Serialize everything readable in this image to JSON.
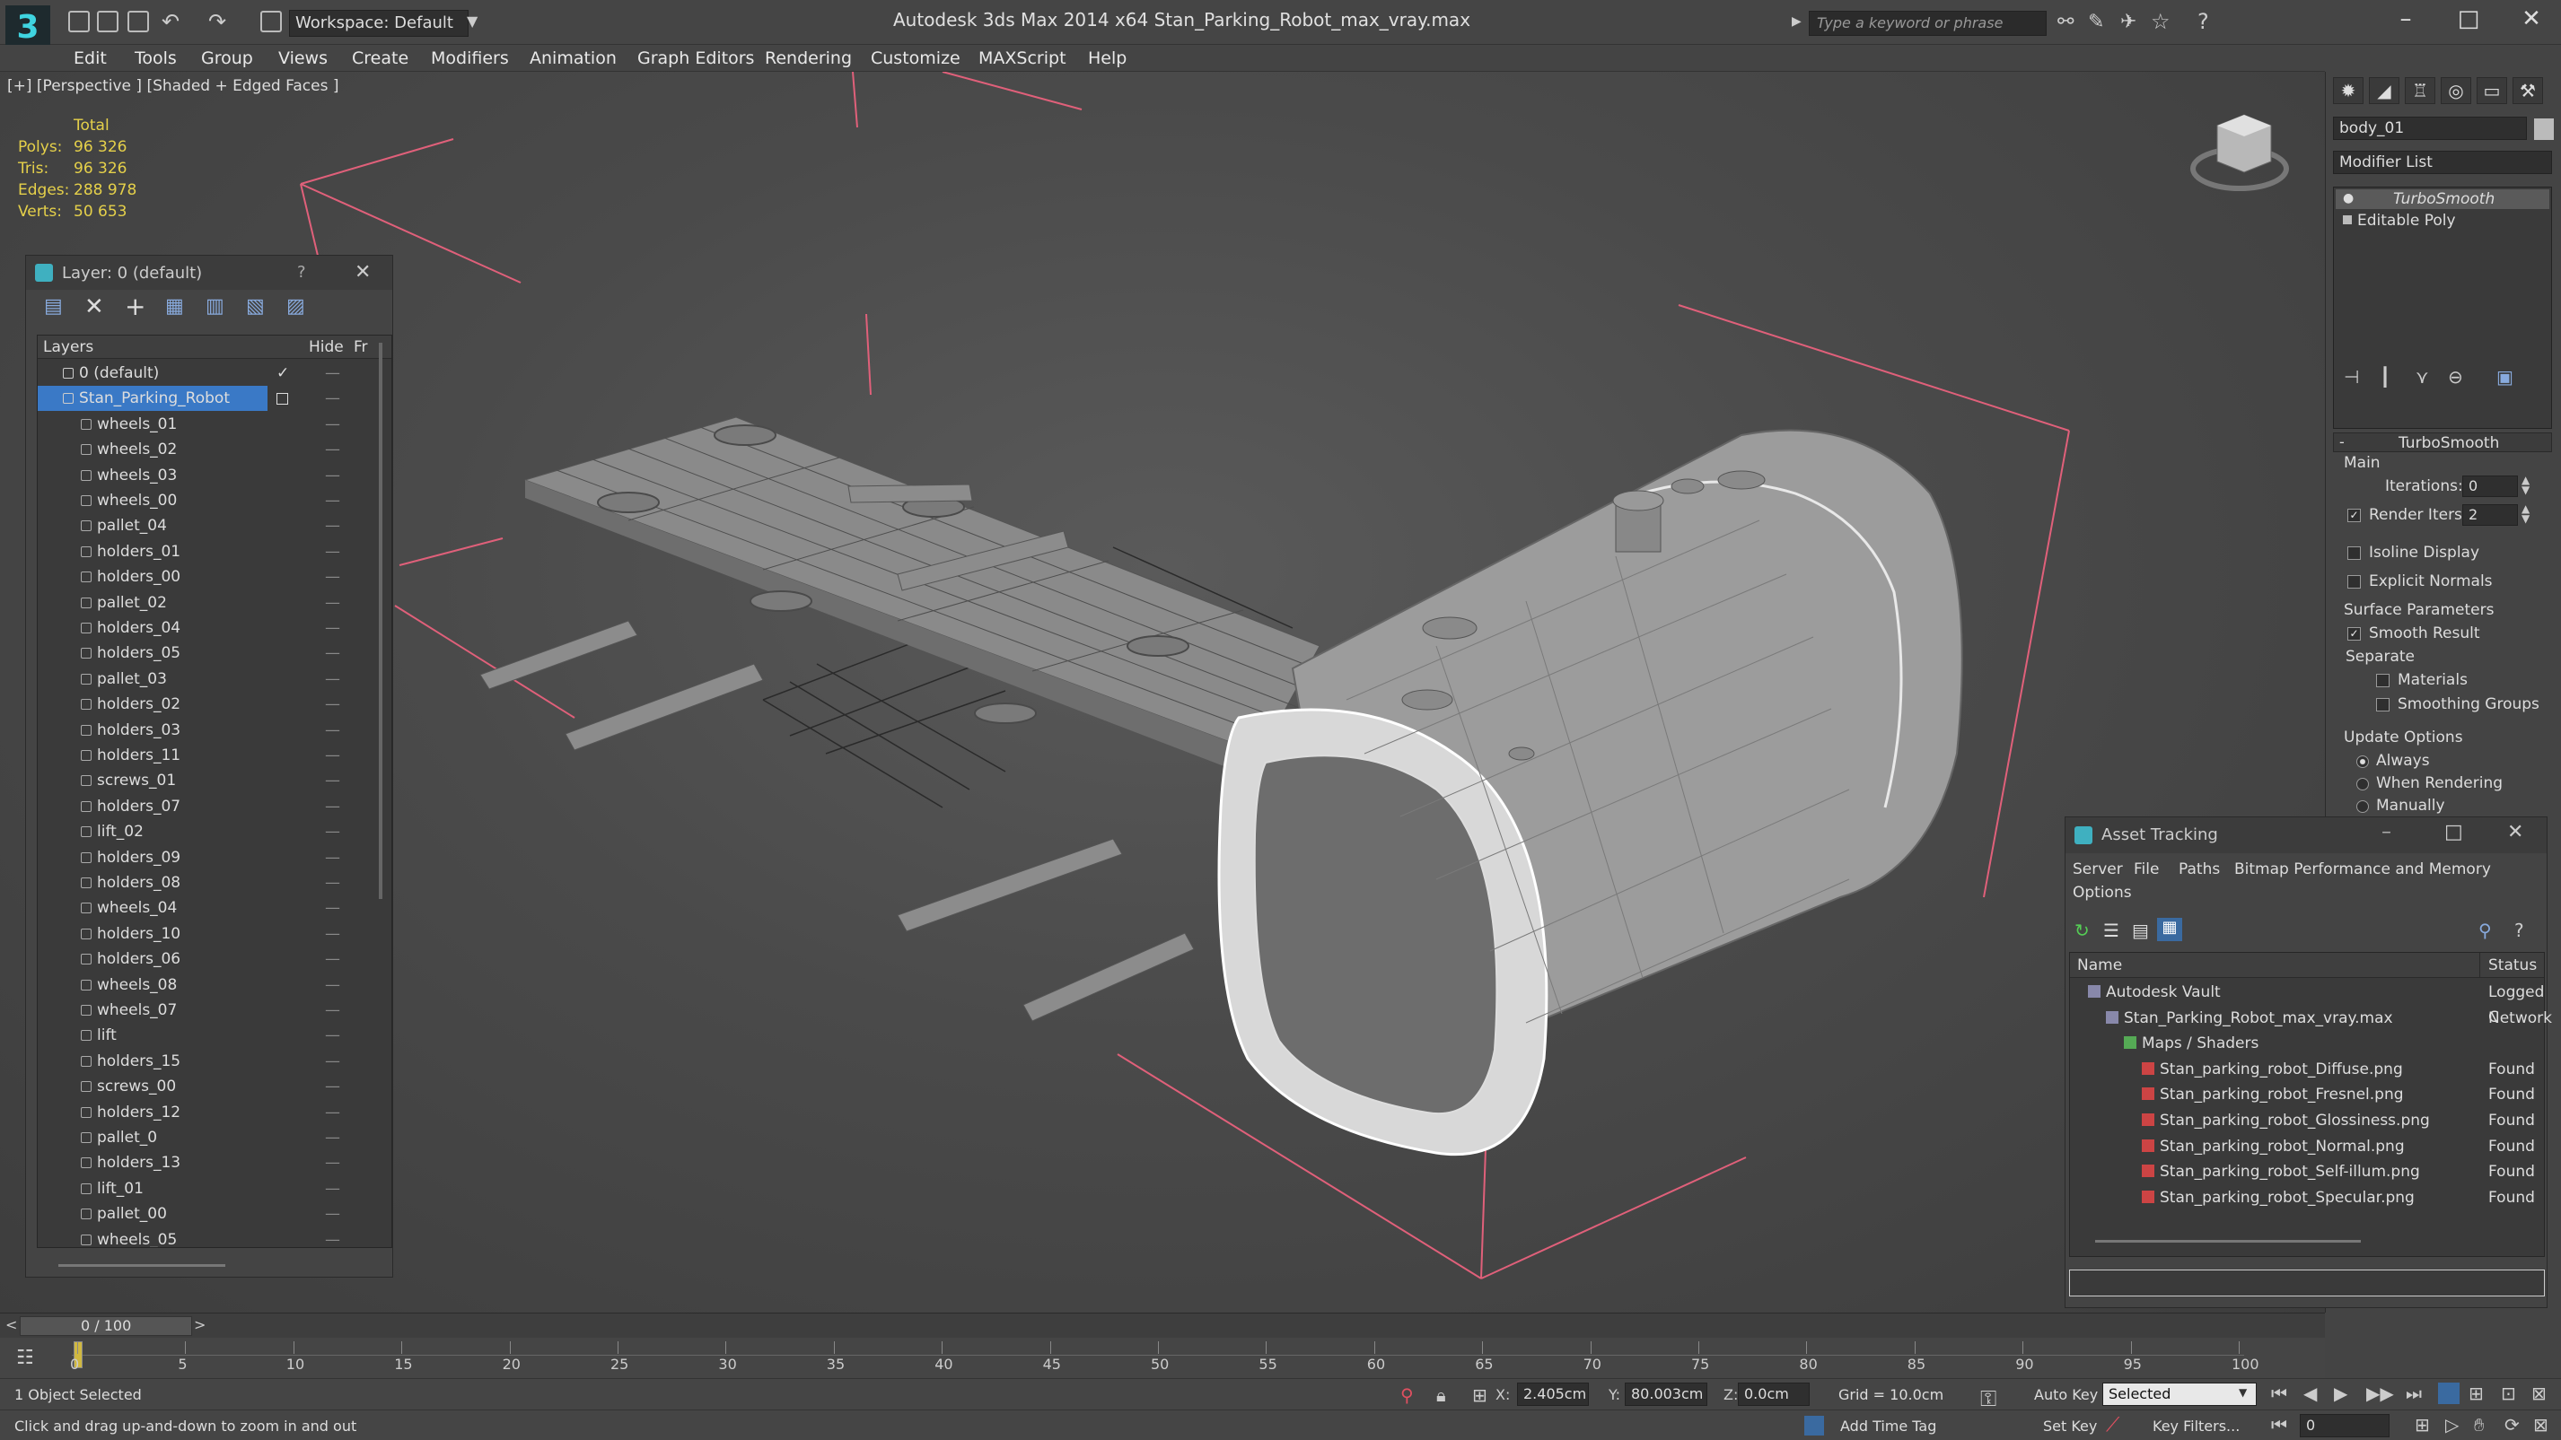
{
  "titlebar": {
    "workspace": "Workspace: Default",
    "app_title": "Autodesk 3ds Max  2014 x64      Stan_Parking_Robot_max_vray.max",
    "search_placeholder": "Type a keyword or phrase"
  },
  "menu": [
    "Edit",
    "Tools",
    "Group",
    "Views",
    "Create",
    "Modifiers",
    "Animation",
    "Graph Editors",
    "Rendering",
    "Customize",
    "MAXScript",
    "Help"
  ],
  "viewport": {
    "label": "[+] [Perspective ] [Shaded + Edged Faces ]",
    "stats": {
      "header": "Total",
      "rows": [
        {
          "label": "Polys:",
          "value": "96 326"
        },
        {
          "label": "Tris:",
          "value": "96 326"
        },
        {
          "label": "Edges:",
          "value": "288 978"
        },
        {
          "label": "Verts:",
          "value": "50 653"
        }
      ]
    }
  },
  "layer_panel": {
    "title": "Layer: 0 (default)",
    "help": "?",
    "col_layers": "Layers",
    "col_hide": "Hide",
    "col_freeze": "Fr",
    "rows": [
      {
        "name": "0 (default)",
        "level": 0,
        "selected": false,
        "check": "✓"
      },
      {
        "name": "Stan_Parking_Robot",
        "level": 0,
        "selected": true,
        "check": ""
      },
      {
        "name": "wheels_01",
        "level": 1
      },
      {
        "name": "wheels_02",
        "level": 1
      },
      {
        "name": "wheels_03",
        "level": 1
      },
      {
        "name": "wheels_00",
        "level": 1
      },
      {
        "name": "pallet_04",
        "level": 1
      },
      {
        "name": "holders_01",
        "level": 1
      },
      {
        "name": "holders_00",
        "level": 1
      },
      {
        "name": "pallet_02",
        "level": 1
      },
      {
        "name": "holders_04",
        "level": 1
      },
      {
        "name": "holders_05",
        "level": 1
      },
      {
        "name": "pallet_03",
        "level": 1
      },
      {
        "name": "holders_02",
        "level": 1
      },
      {
        "name": "holders_03",
        "level": 1
      },
      {
        "name": "holders_11",
        "level": 1
      },
      {
        "name": "screws_01",
        "level": 1
      },
      {
        "name": "holders_07",
        "level": 1
      },
      {
        "name": "lift_02",
        "level": 1
      },
      {
        "name": "holders_09",
        "level": 1
      },
      {
        "name": "holders_08",
        "level": 1
      },
      {
        "name": "wheels_04",
        "level": 1
      },
      {
        "name": "holders_10",
        "level": 1
      },
      {
        "name": "holders_06",
        "level": 1
      },
      {
        "name": "wheels_08",
        "level": 1
      },
      {
        "name": "wheels_07",
        "level": 1
      },
      {
        "name": "lift",
        "level": 1
      },
      {
        "name": "holders_15",
        "level": 1
      },
      {
        "name": "screws_00",
        "level": 1
      },
      {
        "name": "holders_12",
        "level": 1
      },
      {
        "name": "pallet_0",
        "level": 1
      },
      {
        "name": "holders_13",
        "level": 1
      },
      {
        "name": "lift_01",
        "level": 1
      },
      {
        "name": "pallet_00",
        "level": 1
      },
      {
        "name": "wheels_05",
        "level": 1
      }
    ]
  },
  "command_panel": {
    "object_name": "body_01",
    "modifier_list": "Modifier List",
    "stack": [
      "TurboSmooth",
      "Editable Poly"
    ],
    "rollout_title": "TurboSmooth",
    "main": "Main",
    "iterations_label": "Iterations:",
    "iterations_value": "0",
    "render_iters_label": "Render Iters:",
    "render_iters_value": "2",
    "isoline": "Isoline Display",
    "explicit_normals": "Explicit Normals",
    "surface_params": "Surface Parameters",
    "smooth_result": "Smooth Result",
    "separate": "Separate",
    "materials": "Materials",
    "smoothing_groups": "Smoothing Groups",
    "update_options": "Update Options",
    "always": "Always",
    "when_rendering": "When Rendering",
    "manually": "Manually"
  },
  "asset_tracking": {
    "title": "Asset Tracking",
    "menu": [
      "Server",
      "File",
      "Paths",
      "Bitmap Performance and Memory"
    ],
    "options": "Options",
    "col_name": "Name",
    "col_status": "Status",
    "rows": [
      {
        "name": "Autodesk Vault",
        "status": "Logged C",
        "indent": 1
      },
      {
        "name": "Stan_Parking_Robot_max_vray.max",
        "status": "Network",
        "indent": 2
      },
      {
        "name": "Maps / Shaders",
        "status": "",
        "indent": 3
      },
      {
        "name": "Stan_parking_robot_Diffuse.png",
        "status": "Found",
        "indent": 4
      },
      {
        "name": "Stan_parking_robot_Fresnel.png",
        "status": "Found",
        "indent": 4
      },
      {
        "name": "Stan_parking_robot_Glossiness.png",
        "status": "Found",
        "indent": 4
      },
      {
        "name": "Stan_parking_robot_Normal.png",
        "status": "Found",
        "indent": 4
      },
      {
        "name": "Stan_parking_robot_Self-illum.png",
        "status": "Found",
        "indent": 4
      },
      {
        "name": "Stan_parking_robot_Specular.png",
        "status": "Found",
        "indent": 4
      }
    ]
  },
  "timeline": {
    "frame": "0 / 100",
    "ticks": [
      "0",
      "5",
      "10",
      "15",
      "20",
      "25",
      "30",
      "35",
      "40",
      "45",
      "50",
      "55",
      "60",
      "65",
      "70",
      "75",
      "80",
      "85",
      "90",
      "95",
      "100"
    ]
  },
  "status": {
    "selection": "1 Object Selected",
    "hint": "Click and drag up-and-down to zoom in and out",
    "x_label": "X:",
    "x_value": "2.405cm",
    "y_label": "Y:",
    "y_value": "80.003cm",
    "z_label": "Z:",
    "z_value": "0.0cm",
    "grid": "Grid = 10.0cm",
    "auto_key": "Auto Key",
    "selected": "Selected",
    "set_key": "Set Key",
    "key_filters": "Key Filters...",
    "add_time_tag": "Add Time Tag",
    "frame_value": "0"
  }
}
